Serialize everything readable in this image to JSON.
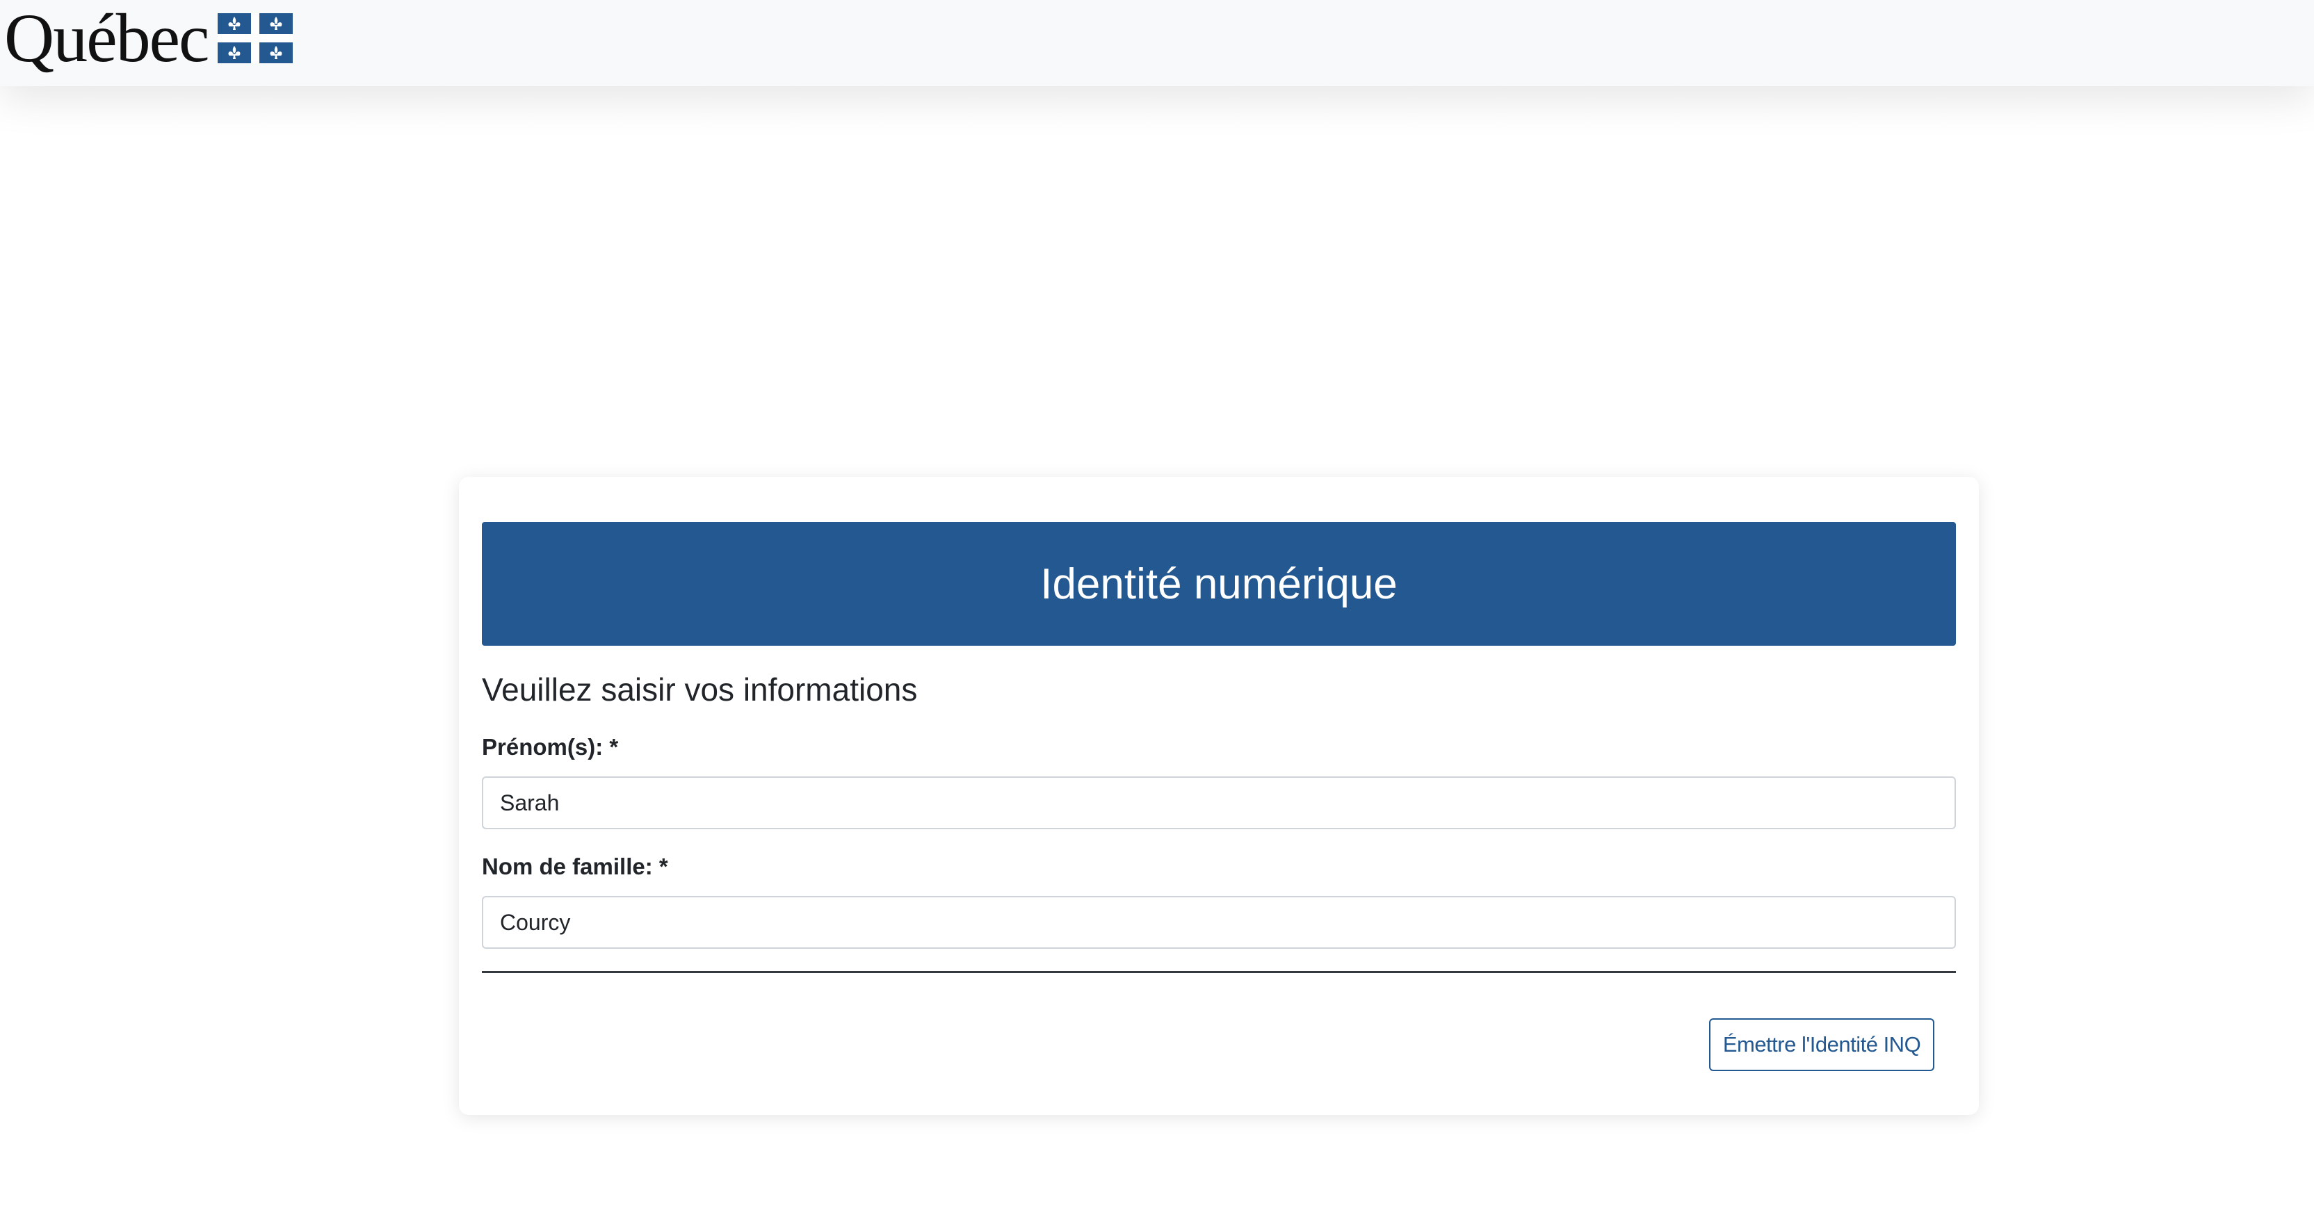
{
  "header": {
    "logo_text": "Québec",
    "flag_icon": "quebec-fleurdelise-flag-icon",
    "flag_color": "#245891"
  },
  "card": {
    "title": "Identité numérique",
    "subtitle": "Veuillez saisir vos informations",
    "fields": {
      "first_name": {
        "label": "Prénom(s): *",
        "value": "Sarah"
      },
      "last_name": {
        "label": "Nom de famille: *",
        "value": "Courcy"
      }
    },
    "submit_label": "Émettre l'Identité INQ"
  },
  "colors": {
    "primary": "#245891",
    "topbar_bg": "#f8f9fa",
    "text": "#212529"
  }
}
